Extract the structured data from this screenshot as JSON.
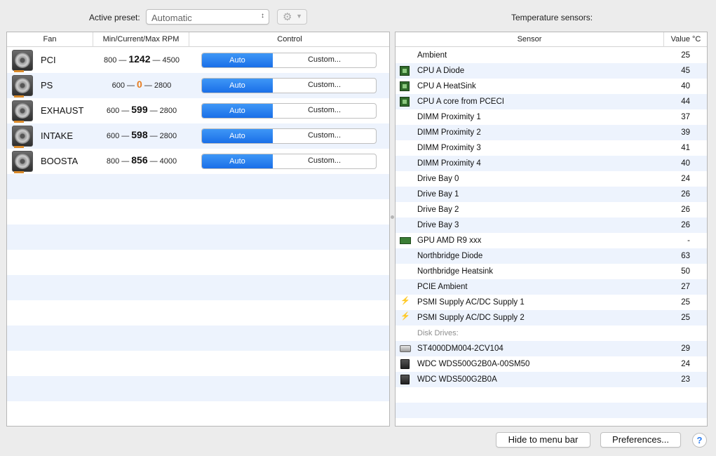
{
  "preset": {
    "label": "Active preset:",
    "value": "Automatic",
    "gear_icon": "gear-icon"
  },
  "fans_table": {
    "headers": [
      "Fan",
      "Min/Current/Max RPM",
      "Control"
    ],
    "rows": [
      {
        "name": "PCI",
        "min": "800",
        "current": "1242",
        "max": "4500",
        "auto": "Auto",
        "custom": "Custom..."
      },
      {
        "name": "PS",
        "min": "600",
        "current": "0",
        "max": "2800",
        "auto": "Auto",
        "custom": "Custom..."
      },
      {
        "name": "EXHAUST",
        "min": "600",
        "current": "599",
        "max": "2800",
        "auto": "Auto",
        "custom": "Custom..."
      },
      {
        "name": "INTAKE",
        "min": "600",
        "current": "598",
        "max": "2800",
        "auto": "Auto",
        "custom": "Custom..."
      },
      {
        "name": "BOOSTA",
        "min": "800",
        "current": "856",
        "max": "4000",
        "auto": "Auto",
        "custom": "Custom..."
      }
    ],
    "separator": "—",
    "highlight_color": "#e87c1e"
  },
  "sensors": {
    "title": "Temperature sensors:",
    "headers": [
      "Sensor",
      "Value °C"
    ],
    "rows": [
      {
        "name": "Ambient",
        "value": "25",
        "icon": "none"
      },
      {
        "name": "CPU A Diode",
        "value": "45",
        "icon": "chip"
      },
      {
        "name": "CPU A HeatSink",
        "value": "40",
        "icon": "chip"
      },
      {
        "name": "CPU A core from PCECI",
        "value": "44",
        "icon": "chip"
      },
      {
        "name": "DIMM Proximity 1",
        "value": "37",
        "icon": "none"
      },
      {
        "name": "DIMM Proximity 2",
        "value": "39",
        "icon": "none"
      },
      {
        "name": "DIMM Proximity 3",
        "value": "41",
        "icon": "none"
      },
      {
        "name": "DIMM Proximity 4",
        "value": "40",
        "icon": "none"
      },
      {
        "name": "Drive Bay 0",
        "value": "24",
        "icon": "none"
      },
      {
        "name": "Drive Bay 1",
        "value": "26",
        "icon": "none"
      },
      {
        "name": "Drive Bay 2",
        "value": "26",
        "icon": "none"
      },
      {
        "name": "Drive Bay 3",
        "value": "26",
        "icon": "none"
      },
      {
        "name": "GPU AMD R9 xxx",
        "value": "-",
        "icon": "gpu"
      },
      {
        "name": "Northbridge Diode",
        "value": "63",
        "icon": "none"
      },
      {
        "name": "Northbridge Heatsink",
        "value": "50",
        "icon": "none"
      },
      {
        "name": "PCIE Ambient",
        "value": "27",
        "icon": "none"
      },
      {
        "name": "PSMI Supply AC/DC Supply 1",
        "value": "25",
        "icon": "bolt"
      },
      {
        "name": "PSMI Supply AC/DC Supply 2",
        "value": "25",
        "icon": "bolt"
      },
      {
        "group": "Disk Drives:"
      },
      {
        "name": "ST4000DM004-2CV104",
        "value": "29",
        "icon": "hdd"
      },
      {
        "name": "WDC  WDS500G2B0A-00SM50",
        "value": "24",
        "icon": "ssd"
      },
      {
        "name": "WDC WDS500G2B0A",
        "value": "23",
        "icon": "ssd"
      }
    ]
  },
  "footer": {
    "hide_label": "Hide to menu bar",
    "prefs_label": "Preferences...",
    "help_label": "?"
  },
  "colors": {
    "accent": "#1a6fe8",
    "row_alt": "#edf3fd"
  }
}
